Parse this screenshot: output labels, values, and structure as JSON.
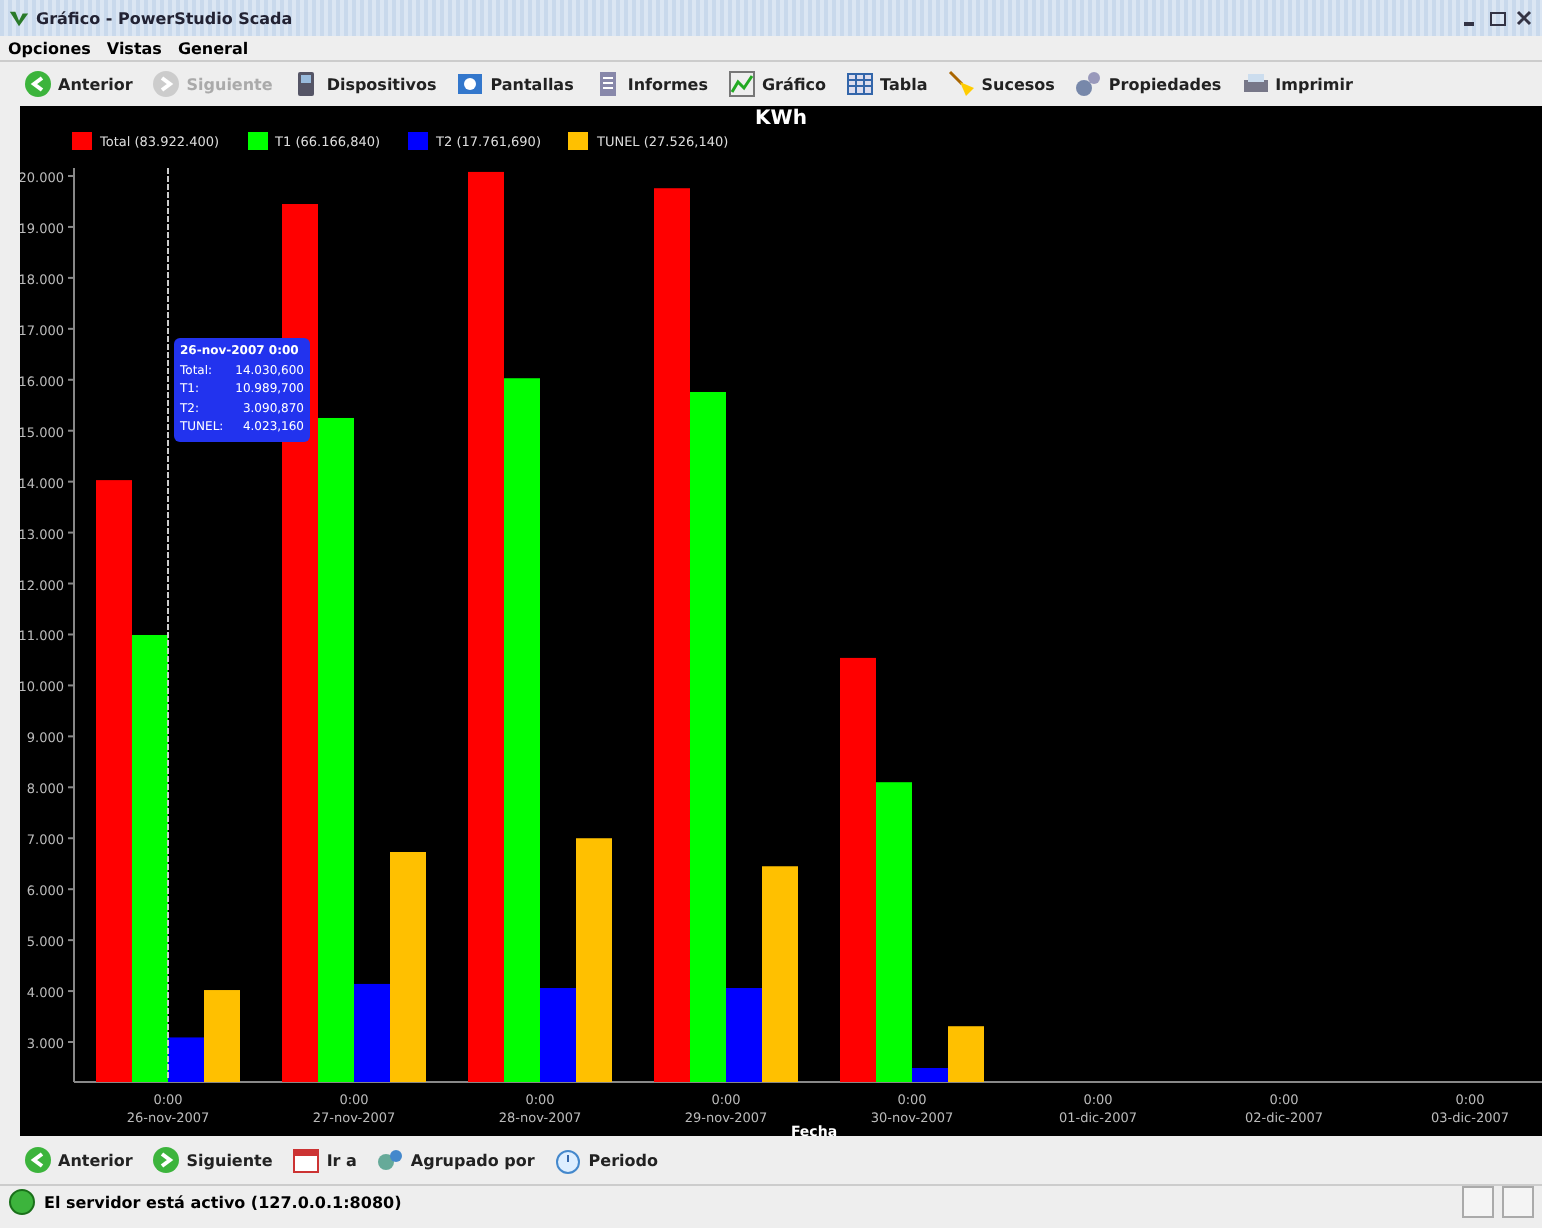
{
  "window": {
    "title": "Gráfico - PowerStudio Scada"
  },
  "menu": [
    "Opciones",
    "Vistas",
    "General"
  ],
  "toolbar": [
    {
      "label": "Anterior",
      "disabled": false
    },
    {
      "label": "Siguiente",
      "disabled": true
    },
    {
      "label": "Dispositivos",
      "disabled": false
    },
    {
      "label": "Pantallas",
      "disabled": false
    },
    {
      "label": "Informes",
      "disabled": false
    },
    {
      "label": "Gráfico",
      "disabled": false
    },
    {
      "label": "Tabla",
      "disabled": false
    },
    {
      "label": "Sucesos",
      "disabled": false
    },
    {
      "label": "Propiedades",
      "disabled": false
    },
    {
      "label": "Imprimir",
      "disabled": false
    }
  ],
  "chart": {
    "legend_totals": [
      "(83.922.400)",
      "(66.166,840)",
      "(17.761,690)",
      "(27.526,140)"
    ],
    "tick_times": [
      "0:00",
      "0:00",
      "0:00",
      "0:00",
      "0:00",
      "0:00",
      "0:00",
      "0:00"
    ],
    "tooltip": {
      "title": "26-nov-2007 0:00",
      "rows": [
        {
          "label": "Total:",
          "value": "14.030,600"
        },
        {
          "label": "T1:",
          "value": "10.989,700"
        },
        {
          "label": "T2:",
          "value": "3.090,870"
        },
        {
          "label": "TUNEL:",
          "value": "4.023,160"
        }
      ]
    },
    "chart_data": {
      "type": "bar",
      "title": "KWh",
      "xlabel": "Fecha",
      "categories": [
        "26-nov-2007",
        "27-nov-2007",
        "28-nov-2007",
        "29-nov-2007",
        "30-nov-2007",
        "01-dic-2007",
        "02-dic-2007",
        "03-dic-2007"
      ],
      "series": [
        {
          "name": "Total",
          "color": "#ff0000",
          "values": [
            14030,
            19450,
            20080,
            19760,
            10540,
            null,
            null,
            null
          ]
        },
        {
          "name": "T1",
          "color": "#00ff00",
          "values": [
            10990,
            15250,
            16030,
            15760,
            8100,
            null,
            null,
            null
          ]
        },
        {
          "name": "T2",
          "color": "#0000ff",
          "values": [
            3090,
            4140,
            4060,
            4060,
            2490,
            null,
            null,
            null
          ]
        },
        {
          "name": "TUNEL",
          "color": "#ffc000",
          "values": [
            4020,
            6730,
            7000,
            6450,
            3310,
            null,
            null,
            null
          ]
        }
      ],
      "ylim": [
        2215,
        20157
      ],
      "yticks": [
        {
          "value": 3000,
          "label": "3.000"
        },
        {
          "value": 4000,
          "label": "4.000"
        },
        {
          "value": 5000,
          "label": "5.000"
        },
        {
          "value": 6000,
          "label": "6.000"
        },
        {
          "value": 7000,
          "label": "7.000"
        },
        {
          "value": 8000,
          "label": "8.000"
        },
        {
          "value": 9000,
          "label": "9.000"
        },
        {
          "value": 10000,
          "label": "10.000"
        },
        {
          "value": 11000,
          "label": "11.000"
        },
        {
          "value": 12000,
          "label": "12.000"
        },
        {
          "value": 13000,
          "label": "13.000"
        },
        {
          "value": 14000,
          "label": "14.000"
        },
        {
          "value": 15000,
          "label": "15.000"
        },
        {
          "value": 16000,
          "label": "16.000"
        },
        {
          "value": 17000,
          "label": "17.000"
        },
        {
          "value": 18000,
          "label": "18.000"
        },
        {
          "value": 19000,
          "label": "19.000"
        },
        {
          "value": 20000,
          "label": "20.000"
        }
      ]
    }
  },
  "bottom_toolbar": [
    {
      "label": "Anterior"
    },
    {
      "label": "Siguiente"
    },
    {
      "label": "Ir a"
    },
    {
      "label": "Agrupado por"
    },
    {
      "label": "Periodo"
    }
  ],
  "status_bar": {
    "text": "El servidor está activo (127.0.0.1:8080)"
  }
}
